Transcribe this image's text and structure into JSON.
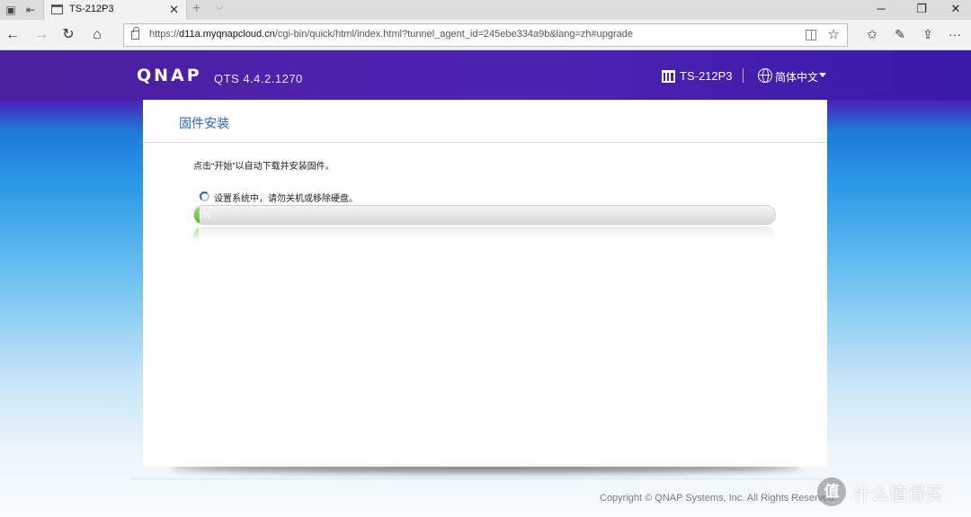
{
  "browser": {
    "tab_title": "TS-212P3",
    "new_tab": "+",
    "url_scheme": "https://",
    "url_host": "d11a.myqnapcloud.cn",
    "url_path": "/cgi-bin/quick/html/index.html?tunnel_agent_id=245ebe334a9b&lang=zh#upgrade",
    "icons": {
      "back": "arrow-left-icon",
      "forward": "arrow-right-icon",
      "refresh": "refresh-icon",
      "home": "home-icon",
      "lock": "lock-icon",
      "reader": "reading-view-icon",
      "favorite": "star-icon",
      "favorites_hub": "favorites-hub-icon",
      "notes": "pen-icon",
      "share": "share-icon",
      "more": "more-icon"
    }
  },
  "header": {
    "logo": "QNAP",
    "version": "QTS 4.4.2.1270",
    "device_name": "TS-212P3",
    "language": "简体中文"
  },
  "card": {
    "title": "固件安装",
    "instruction": "点击“开始”以自动下载并安装固件。",
    "status": "设置系统中，请勿关机或移除硬盘。",
    "progress_label": "1%",
    "progress_value": 0.01
  },
  "footer": {
    "copyright": "Copyright © QNAP Systems, Inc. All Rights Reserved."
  },
  "watermark": {
    "symbol": "值",
    "text": "什么值得买"
  },
  "colors": {
    "header_bg": "#4b1f9e",
    "title_blue": "#2a62b8",
    "progress_green": "#4fb82e"
  }
}
